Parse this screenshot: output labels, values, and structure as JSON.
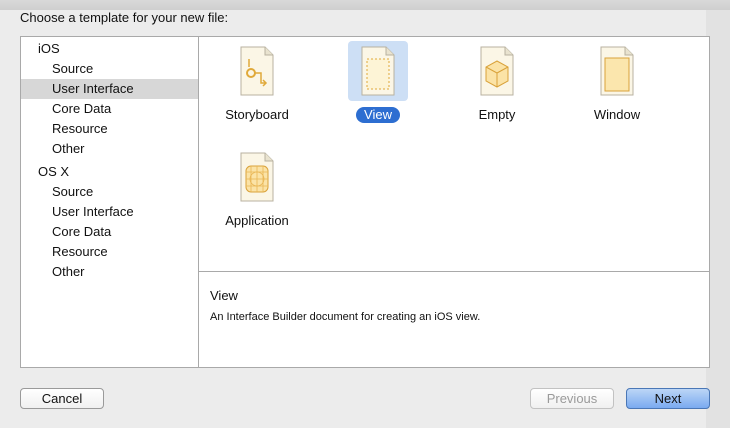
{
  "dialog": {
    "prompt": "Choose a template for your new file:"
  },
  "sidebar": {
    "groups": [
      {
        "label": "iOS",
        "items": [
          "Source",
          "User Interface",
          "Core Data",
          "Resource",
          "Other"
        ]
      },
      {
        "label": "OS X",
        "items": [
          "Source",
          "User Interface",
          "Core Data",
          "Resource",
          "Other"
        ]
      }
    ],
    "selected": "iOS / User Interface"
  },
  "templates": [
    {
      "label": "Storyboard",
      "icon": "storyboard-document-icon",
      "selected": false
    },
    {
      "label": "View",
      "icon": "view-document-icon",
      "selected": true
    },
    {
      "label": "Empty",
      "icon": "empty-cube-document-icon",
      "selected": false
    },
    {
      "label": "Window",
      "icon": "window-document-icon",
      "selected": false
    },
    {
      "label": "Application",
      "icon": "application-document-icon",
      "selected": false
    }
  ],
  "description": {
    "title": "View",
    "text": "An Interface Builder document for creating an iOS view."
  },
  "buttons": {
    "cancel": "Cancel",
    "previous": "Previous",
    "next": "Next"
  },
  "colors": {
    "selection_blue": "#2d6ed1",
    "icon_highlight": "#cddff5",
    "sidebar_selection": "#d7d7d7"
  }
}
